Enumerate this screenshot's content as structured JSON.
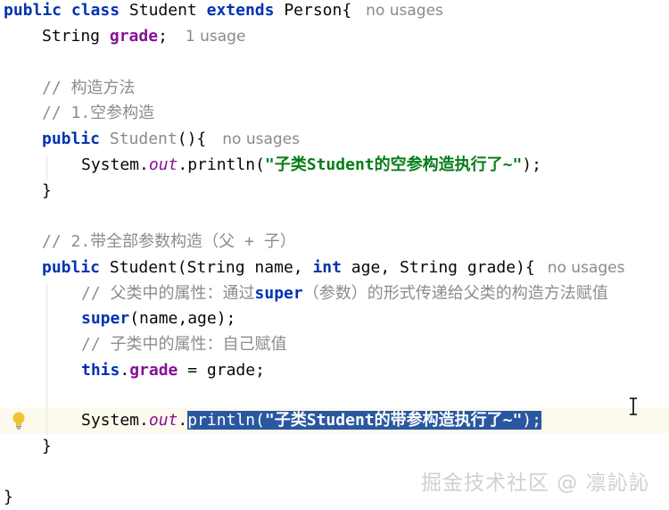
{
  "hints": {
    "no_usages": "no usages",
    "one_usage": "1 usage"
  },
  "code": {
    "l1_public": "public",
    "l1_class": "class",
    "l1_name": "Student",
    "l1_extends": "extends",
    "l1_parent": "Person{",
    "l2_type": "String",
    "l2_field": "grade",
    "l2_semi": ";",
    "l4_comment": "// 构造方法",
    "l5_comment": "// 1.空参构造",
    "l6_public": "public",
    "l6_name": "Student",
    "l6_rest": "(){",
    "l7_system": "System.",
    "l7_out": "out",
    "l7_println": ".println(",
    "l7_string": "\"子类Student的空参构造执行了~\"",
    "l7_end": ");",
    "l8_close": "}",
    "l10_comment": "// 2.带全部参数构造（父 + 子）",
    "l11_public": "public",
    "l11_sig1": "Student(String name, ",
    "l11_int": "int",
    "l11_sig2": " age, String grade){",
    "l12_comment_a": "// 父类中的属性：通过",
    "l12_comment_super": "super",
    "l12_comment_b": "（参数）的形式传递给父类的构造方法赋值",
    "l13_super": "super",
    "l13_rest": "(name,age);",
    "l14_comment": "// 子类中的属性：自己赋值",
    "l15_this": "this",
    "l15_dot": ".",
    "l15_field": "grade",
    "l15_rest": " = grade;",
    "l17_system": "System.",
    "l17_out": "out",
    "l17_dot": ".",
    "l17_println": "println(",
    "l17_string": "\"子类Student的带参构造执行了~\"",
    "l17_end": ");",
    "l18_close": "}",
    "l20_close": "}"
  },
  "watermark": "掘金技术社区 @ 凛訫訫",
  "colors": {
    "keyword": "#0033b3",
    "field": "#871094",
    "string": "#067d17",
    "comment": "#8c8c8c",
    "selection": "#2a57a0",
    "caret_line": "#fcfaed"
  },
  "icons": {
    "gutter": "lightbulb-icon",
    "mouse": "text-cursor-icon"
  }
}
